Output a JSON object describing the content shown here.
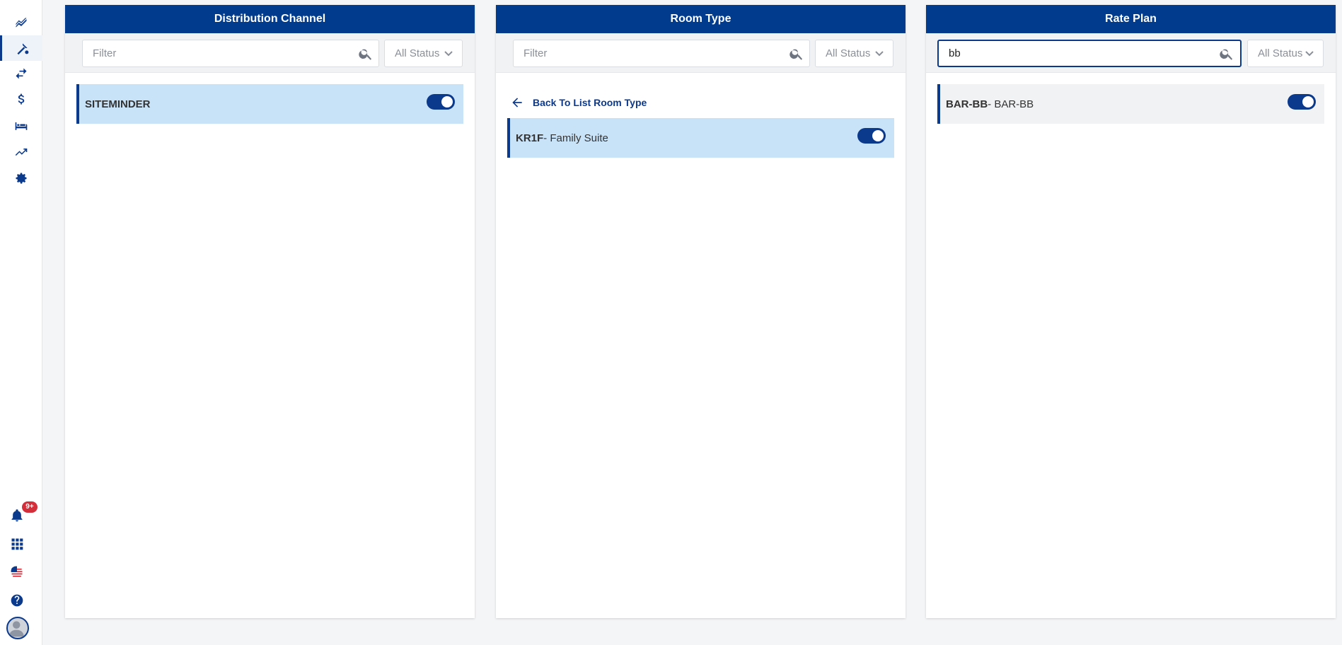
{
  "sidebar": {
    "items": [
      {
        "name": "dashboard-icon"
      },
      {
        "name": "rate-icon",
        "active": true
      },
      {
        "name": "transfer-icon"
      },
      {
        "name": "dollar-icon"
      },
      {
        "name": "bed-icon"
      },
      {
        "name": "trend-icon"
      },
      {
        "name": "gear-icon"
      }
    ],
    "bottom": [
      {
        "name": "bell-icon"
      },
      {
        "name": "apps-grid-icon"
      },
      {
        "name": "us-flag-icon"
      },
      {
        "name": "help-icon"
      }
    ],
    "notification_badge": "9+"
  },
  "panels": {
    "distribution": {
      "title": "Distribution Channel",
      "filter_placeholder": "Filter",
      "filter_value": "",
      "status": "All Status",
      "items": [
        {
          "code": "SITEMINDER",
          "name": "",
          "enabled": true
        }
      ]
    },
    "room_type": {
      "title": "Room Type",
      "filter_placeholder": "Filter",
      "filter_value": "",
      "status": "All Status",
      "back_label": "Back To List Room Type",
      "items": [
        {
          "code": "KR1F",
          "name": "- Family Suite",
          "enabled": true
        }
      ]
    },
    "rate_plan": {
      "title": "Rate Plan",
      "filter_placeholder": "Filter",
      "filter_value": "bb",
      "status": "All Status",
      "items": [
        {
          "code": "BAR-BB",
          "name": "- BAR-BB",
          "enabled": true
        }
      ]
    }
  },
  "colors": {
    "primary": "#003b8e",
    "selected_row": "#c8e2f8",
    "badge": "#d32f3b"
  }
}
